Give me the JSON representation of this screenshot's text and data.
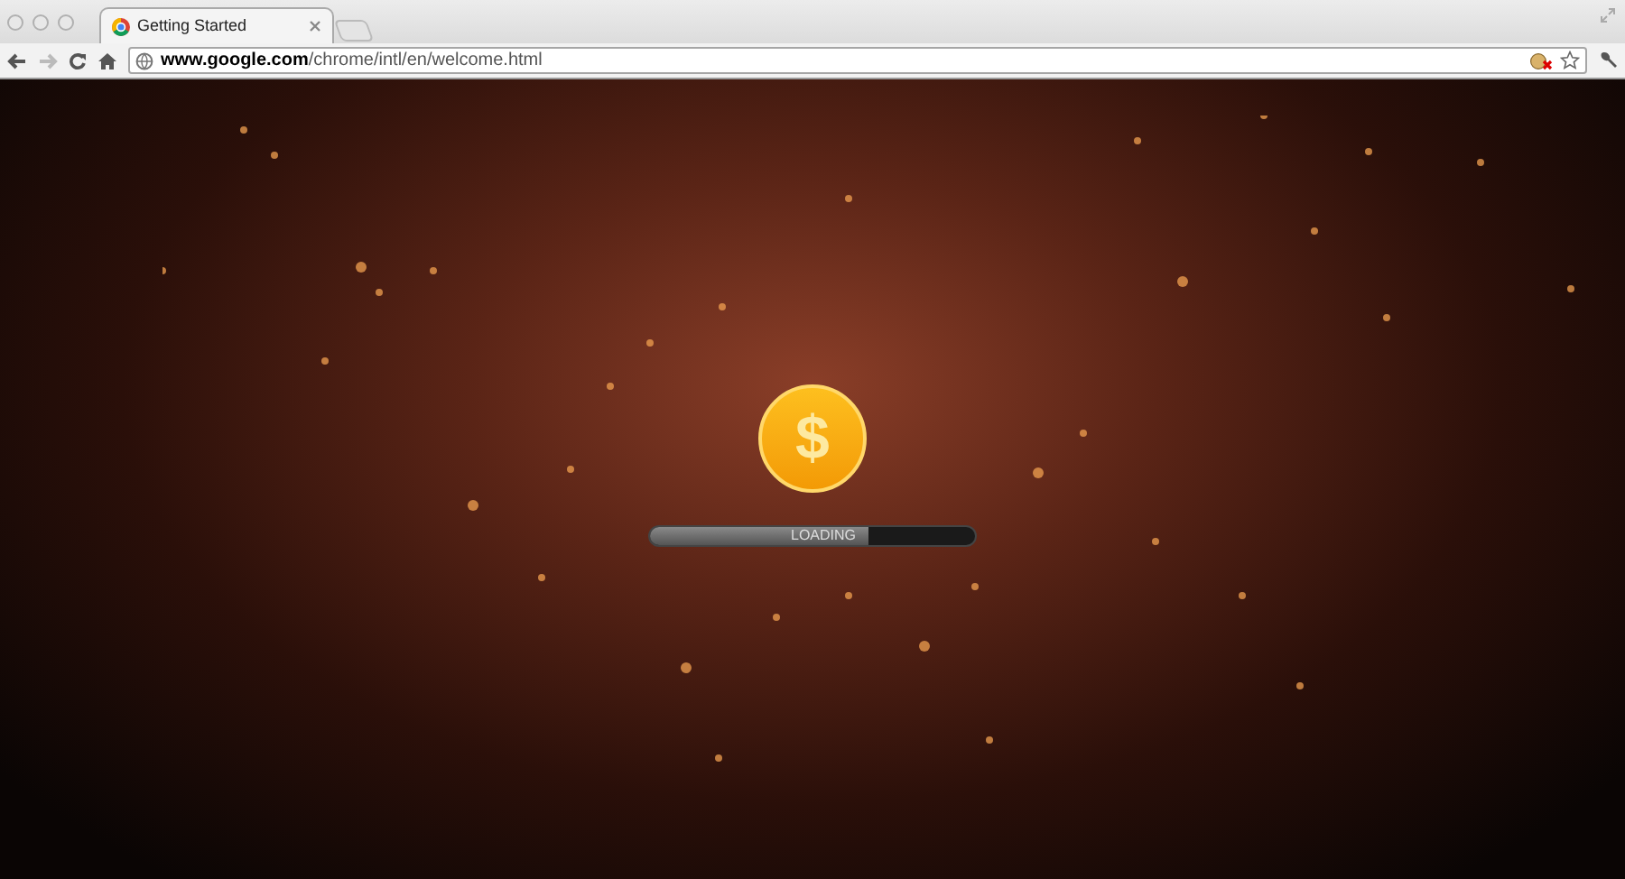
{
  "tabs": [
    {
      "title": "Getting Started",
      "selected": true
    }
  ],
  "address_bar": {
    "host": "www.google.com",
    "path": "/chrome/intl/en/welcome.html"
  },
  "page": {
    "coin_symbol": "$",
    "loading": {
      "label": "LOADING",
      "level": 0.67
    }
  }
}
